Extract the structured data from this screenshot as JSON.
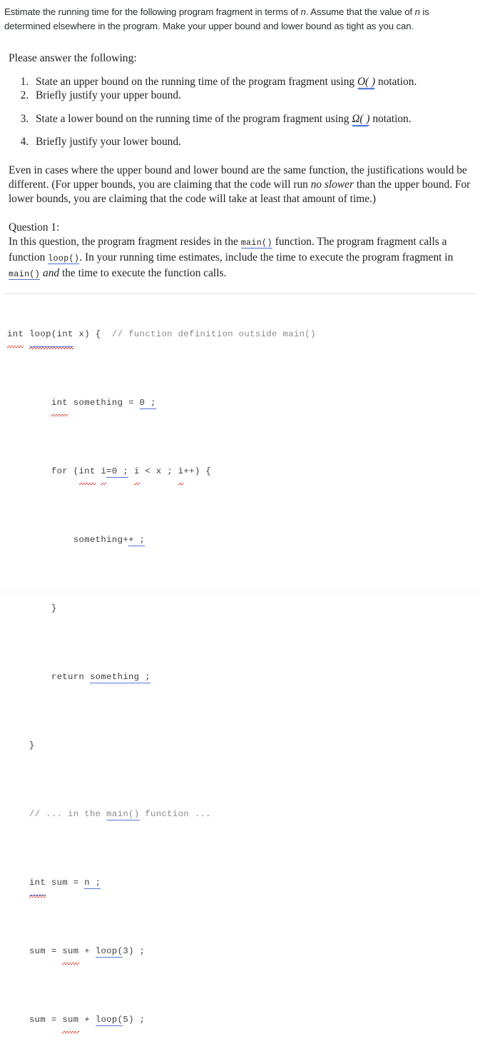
{
  "intro": {
    "part1": "Estimate the running time for the following program fragment in terms of ",
    "var1": "n",
    "part2": ". Assume that the value of ",
    "var2": "n",
    "part3": " is determined elsewhere in the program. Make your upper bound and lower bound as tight as you can."
  },
  "lead": "Please answer the following:",
  "questions": [
    {
      "pre": "State an upper bound on the running time of the program fragment using ",
      "notation": "O( )",
      "post": " notation."
    },
    {
      "pre": "Briefly justify your upper bound.",
      "notation": "",
      "post": ""
    },
    {
      "pre": "State a lower bound on the running time of the program fragment using ",
      "notation": "Ω( )",
      "post": " notation."
    },
    {
      "pre": "Briefly justify your lower bound.",
      "notation": "",
      "post": ""
    }
  ],
  "note": {
    "part1": "Even in cases where the upper bound and lower bound are the same function, the justifications would be different. (For upper bounds, you are claiming that the code will run ",
    "em1": "no slower",
    "part2": " than the upper bound. For lower bounds, you are claiming that the code will take at least that amount of time.)"
  },
  "question1": {
    "heading": "Question 1:",
    "part1": "In this question, the program fragment resides in the ",
    "code1": "main()",
    "part2": " function. The program fragment calls a function ",
    "code2": "loop()",
    "part3": ". In your running time estimates, include the time to execute the program fragment in ",
    "code3": "main()",
    "em1": "and",
    "part4": " the time to execute the function calls."
  },
  "code": {
    "line1": {
      "t1": "int",
      "t2": " ",
      "t3": "loop(int",
      "t4": " x) {  ",
      "comment": "// function definition outside main()"
    },
    "line2": {
      "indent": "        ",
      "t1": "int",
      "t2": " something = ",
      "t3": "0 ;"
    },
    "line3": {
      "indent": "        ",
      "t1": "for (",
      "t2": "int",
      "t3": " ",
      "t4": "i",
      "t5": "=0 ;",
      "t6": " ",
      "t7": "i",
      "t8": " < x ; ",
      "t9": "i",
      "t10": "++) {"
    },
    "line4": {
      "indent": "            ",
      "t1": "something+",
      "t2": "+ ;"
    },
    "line5": {
      "indent": "        ",
      "t1": "}"
    },
    "line6": {
      "indent": "        ",
      "t1": "return ",
      "t2": "something ;"
    },
    "line7": {
      "indent": "    ",
      "t1": "}"
    },
    "line8": {
      "indent": "    ",
      "t1": "// ... in the ",
      "t2": "main()",
      "t3": " function ..."
    },
    "line9": {
      "indent": "    ",
      "t1": "int",
      "t2": " sum = ",
      "t3": "n ;"
    },
    "line10": {
      "indent": "    ",
      "t1": "sum = ",
      "t2": "sum",
      "t3": " + ",
      "t4": "loop(",
      "t5": "3) ;"
    },
    "line11": {
      "indent": "    ",
      "t1": "sum = ",
      "t2": "sum",
      "t3": " + ",
      "t4": "loop(",
      "t5": "5) ;"
    }
  },
  "colors": {
    "blue_underline": "#4a6fd4",
    "red_squiggle": "#e03a2f",
    "comment_gray": "#8a8a8a",
    "divider": "#e3e3e3",
    "intro_text": "#2b2f33",
    "body_text": "#1f1f1f"
  }
}
